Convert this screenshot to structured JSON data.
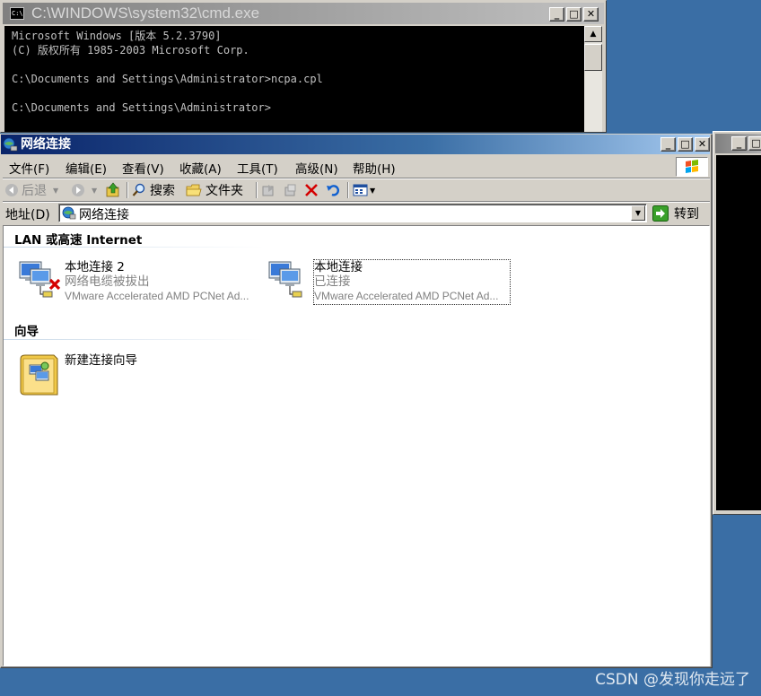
{
  "cmd": {
    "title": "C:\\WINDOWS\\system32\\cmd.exe",
    "title_icon_text": "C:\\",
    "lines": [
      "Microsoft Windows [版本 5.2.3790]",
      "(C) 版权所有 1985-2003 Microsoft Corp.",
      "",
      "C:\\Documents and Settings\\Administrator>ncpa.cpl",
      "",
      "C:\\Documents and Settings\\Administrator>"
    ]
  },
  "window_controls": {
    "minimize": "_",
    "maximize": "□",
    "close": "✕"
  },
  "net": {
    "title": "网络连接",
    "menu": [
      "文件(F)",
      "编辑(E)",
      "查看(V)",
      "收藏(A)",
      "工具(T)",
      "高级(N)",
      "帮助(H)"
    ],
    "toolbar": {
      "back": "后退",
      "search": "搜索",
      "folders": "文件夹"
    },
    "address_label": "地址(D)",
    "address_value": "网络连接",
    "go_label": "转到",
    "groups": [
      {
        "header": "LAN 或高速 Internet",
        "items": [
          {
            "name": "本地连接 2",
            "status": "网络电缆被拔出",
            "device": "VMware Accelerated AMD PCNet Ad...",
            "disconnected": true
          },
          {
            "name": "本地连接",
            "status": "已连接",
            "device": "VMware Accelerated AMD PCNet Ad...",
            "disconnected": false
          }
        ]
      },
      {
        "header": "向导",
        "items": [
          {
            "name": "新建连接向导"
          }
        ]
      }
    ]
  },
  "watermark": "CSDN @发现你走远了",
  "colors": {
    "desktop": "#3a6ea5",
    "active_title_start": "#0a246a",
    "active_title_end": "#a6caf0",
    "inactive_title": "#808080",
    "error_red": "#d40000"
  }
}
